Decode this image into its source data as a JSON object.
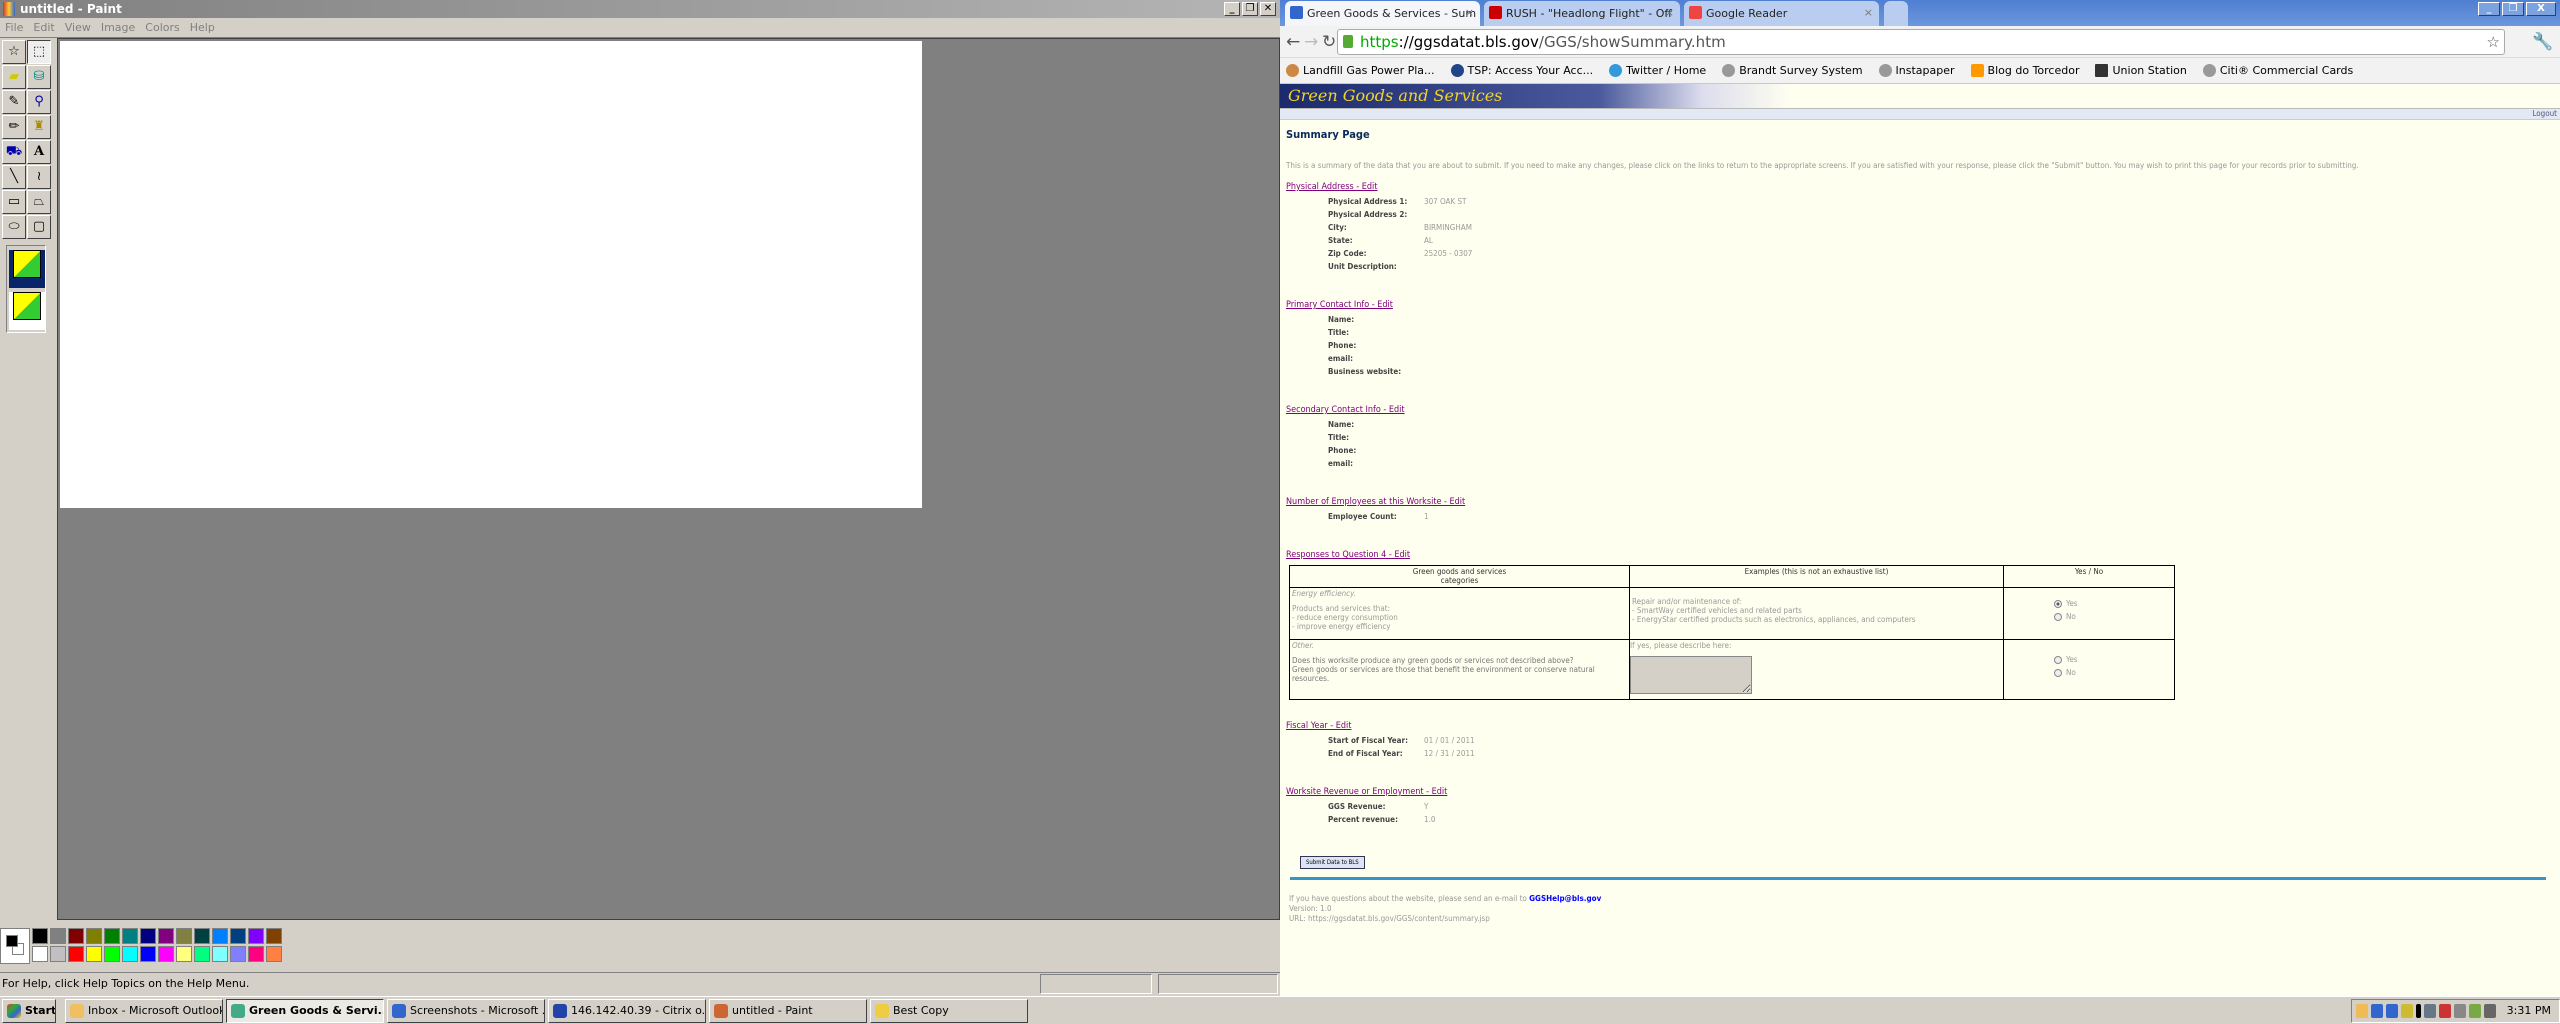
{
  "paint": {
    "title": "untitled - Paint",
    "menu": [
      "File",
      "Edit",
      "View",
      "Image",
      "Colors",
      "Help"
    ],
    "tools": [
      "free-form-select",
      "select",
      "eraser",
      "fill",
      "pick-color",
      "magnifier",
      "pencil",
      "brush",
      "airbrush",
      "text",
      "line",
      "curve",
      "rectangle",
      "polygon",
      "ellipse",
      "rounded-rectangle"
    ],
    "palette": [
      "#000000",
      "#808080",
      "#800000",
      "#808000",
      "#008000",
      "#008080",
      "#000080",
      "#800080",
      "#808040",
      "#004040",
      "#0080ff",
      "#004080",
      "#8000ff",
      "#804000",
      "#ffffff",
      "#c0c0c0",
      "#ff0000",
      "#ffff00",
      "#00ff00",
      "#00ffff",
      "#0000ff",
      "#ff00ff",
      "#ffff80",
      "#00ff80",
      "#80ffff",
      "#8080ff",
      "#ff0080",
      "#ff8040"
    ],
    "status": "For Help, click Help Topics on the Help Menu."
  },
  "taskbar": {
    "start": "Start",
    "items": [
      {
        "label": "Inbox - Microsoft Outlook",
        "color": "#f0c060"
      },
      {
        "label": "Green Goods & Servi...",
        "color": "#4a8",
        "active": true
      },
      {
        "label": "Screenshots - Microsoft ...",
        "color": "#36c"
      },
      {
        "label": "146.142.40.39 - Citrix o...",
        "color": "#24a"
      },
      {
        "label": "untitled - Paint",
        "color": "#c63"
      },
      {
        "label": "Best Copy",
        "color": "#ec4"
      }
    ],
    "clock": "3:31 PM"
  },
  "browser": {
    "tabs": [
      {
        "title": "Green Goods & Services - Sum",
        "color": "#36c"
      },
      {
        "title": "RUSH - \"Headlong Flight\" - Off",
        "color": "#c00"
      },
      {
        "title": "Google Reader",
        "color": "#e44"
      }
    ],
    "url_scheme": "https",
    "url_host": "://ggsdatat.bls.gov",
    "url_path": "/GGS/showSummary.htm",
    "bookmarks": [
      "Landfill Gas Power Pla...",
      "TSP: Access Your Acc...",
      "Twitter / Home",
      "Brandt Survey System",
      "Instapaper",
      "Blog do Torcedor",
      "Union Station",
      "Citi® Commercial Cards"
    ]
  },
  "site": {
    "banner": "Green Goods and Services",
    "logout": "Logout",
    "title": "Summary Page",
    "intro": "This is a summary of the data that you are about to submit. If you need to make any changes, please click on the links to return to the appropriate screens. If you are satisfied with your response, please click the \"Submit\" button. You may wish to print this page for your records prior to submitting.",
    "sections": [
      {
        "link": "Physical Address - Edit",
        "rows": [
          {
            "k": "Physical Address 1:",
            "v": "307 OAK ST"
          },
          {
            "k": "Physical Address 2:",
            "v": ""
          },
          {
            "k": "City:",
            "v": "BIRMINGHAM"
          },
          {
            "k": "State:",
            "v": "AL"
          },
          {
            "k": "Zip Code:",
            "v": "25205 - 0307"
          },
          {
            "k": "Unit Description:",
            "v": ""
          }
        ]
      },
      {
        "link": "Primary Contact Info - Edit",
        "rows": [
          {
            "k": "Name:",
            "v": ""
          },
          {
            "k": "Title:",
            "v": ""
          },
          {
            "k": "Phone:",
            "v": ""
          },
          {
            "k": "email:",
            "v": ""
          },
          {
            "k": "Business website:",
            "v": ""
          }
        ]
      },
      {
        "link": "Secondary Contact Info - Edit",
        "rows": [
          {
            "k": "Name:",
            "v": ""
          },
          {
            "k": "Title:",
            "v": ""
          },
          {
            "k": "Phone:",
            "v": ""
          },
          {
            "k": "email:",
            "v": ""
          }
        ]
      },
      {
        "link": "Number of Employees at this Worksite - Edit",
        "rows": [
          {
            "k": "Employee Count:",
            "v": "1"
          }
        ]
      }
    ],
    "q4": {
      "link": "Responses to Question 4 - Edit",
      "headers": [
        "Green goods and services\ncategories",
        "Examples (this is not an exhaustive list)",
        "Yes / No"
      ],
      "row1": {
        "cat_title": "Energy efficiency.",
        "cat_body": "Products and services that:\n- reduce energy consumption\n- improve energy efficiency",
        "examples": "Repair and/or maintenance of:\n- SmartWay certified vehicles and related parts\n- EnergyStar certified products such as electronics, appliances, and computers",
        "yes": "Yes",
        "no": "No",
        "selected": "Yes"
      },
      "row2": {
        "cat_title": "Other.",
        "cat_body": "Does this worksite produce any green goods or services not described above?\nGreen goods or services are those that benefit the environment or conserve natural resources.",
        "examples": "If yes, please describe here:",
        "textarea": "",
        "yes": "Yes",
        "no": "No",
        "selected": ""
      }
    },
    "sections2": [
      {
        "link": "Fiscal Year - Edit",
        "rows": [
          {
            "k": "Start of Fiscal Year:",
            "v": "01 / 01 / 2011"
          },
          {
            "k": "End of Fiscal Year:",
            "v": "12 / 31 / 2011"
          }
        ]
      },
      {
        "link": "Worksite Revenue or Employment - Edit",
        "rows": [
          {
            "k": "GGS Revenue:",
            "v": "Y"
          },
          {
            "k": "Percent revenue:",
            "v": "1.0"
          }
        ]
      }
    ],
    "submit": "Submit Data to BLS",
    "footer_q": "If you have questions about the website, please send an e-mail to",
    "footer_email": "GGSHelp@bls.gov",
    "version": "Version: 1.0",
    "url": "URL: https://ggsdatat.bls.gov/GGS/content/summary.jsp"
  }
}
